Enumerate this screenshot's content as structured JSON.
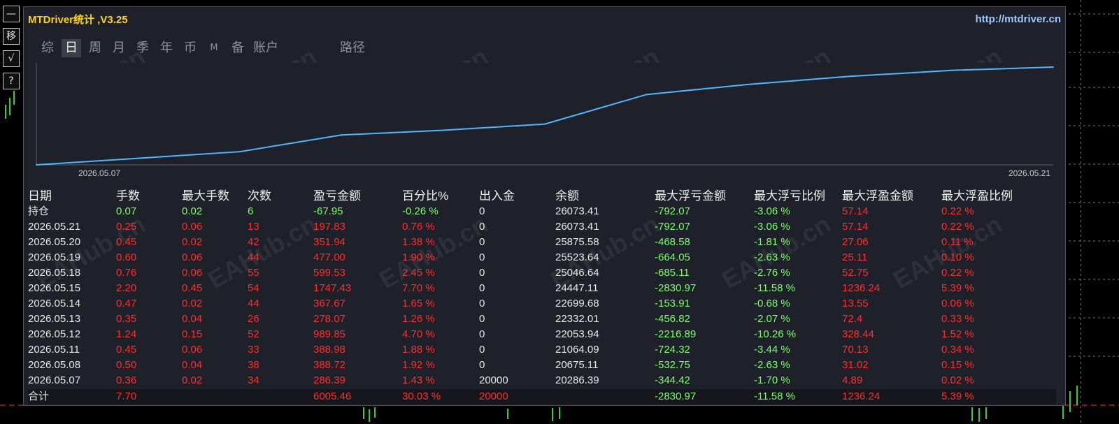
{
  "window": {
    "title": "MTDriver统计 ,V3.25",
    "url": "http://mtdriver.cn"
  },
  "side_tools": [
    "—",
    "移",
    "√",
    "?"
  ],
  "tabs": [
    {
      "label": "综",
      "active": false
    },
    {
      "label": "日",
      "active": true
    },
    {
      "label": "周",
      "active": false
    },
    {
      "label": "月",
      "active": false
    },
    {
      "label": "季",
      "active": false
    },
    {
      "label": "年",
      "active": false
    },
    {
      "label": "币",
      "active": false
    },
    {
      "label": "M",
      "active": false
    },
    {
      "label": "备",
      "active": false
    },
    {
      "label": "账户",
      "active": false
    },
    {
      "label": "路径",
      "active": false
    }
  ],
  "watermark": "EAHub.cn",
  "colors": {
    "line": "#4fb6ff",
    "profit": "#ff2d2d",
    "loss": "#7dff6a",
    "title": "#ffd400"
  },
  "chart_data": {
    "type": "line",
    "x": [
      "2026.05.07",
      "2026.05.08",
      "2026.05.11",
      "2026.05.12",
      "2026.05.13",
      "2026.05.14",
      "2026.05.15",
      "2026.05.18",
      "2026.05.19",
      "2026.05.20",
      "2026.05.21"
    ],
    "series": [
      {
        "values": [
          20286.39,
          20675.11,
          21064.09,
          22053.94,
          22332.01,
          22699.68,
          24447.11,
          25046.64,
          25523.64,
          25875.58,
          26073.41
        ]
      }
    ],
    "xtick_labels": [
      "2026.05.07",
      "2026.05.21"
    ]
  },
  "table": {
    "headers": [
      "日期",
      "手数",
      "最大手数",
      "次数",
      "盈亏金额",
      "百分比%",
      "出入金",
      "余额",
      "最大浮亏金额",
      "最大浮亏比例",
      "最大浮盈金额",
      "最大浮盈比例"
    ],
    "rows": [
      [
        "持仓",
        "0.07",
        "0.02",
        "6",
        "-67.95",
        "-0.26 %",
        "0",
        "26073.41",
        "-792.07",
        "-3.06 %",
        "57.14",
        "0.22 %"
      ],
      [
        "2026.05.21",
        "0.25",
        "0.06",
        "13",
        "197.83",
        "0.76 %",
        "0",
        "26073.41",
        "-792.07",
        "-3.06 %",
        "57.14",
        "0.22 %"
      ],
      [
        "2026.05.20",
        "0.45",
        "0.02",
        "42",
        "351.94",
        "1.38 %",
        "0",
        "25875.58",
        "-468.58",
        "-1.81 %",
        "27.06",
        "0.11 %"
      ],
      [
        "2026.05.19",
        "0.60",
        "0.06",
        "44",
        "477.00",
        "1.90 %",
        "0",
        "25523.64",
        "-664.05",
        "-2.63 %",
        "25.11",
        "0.10 %"
      ],
      [
        "2026.05.18",
        "0.76",
        "0.06",
        "55",
        "599.53",
        "2.45 %",
        "0",
        "25046.64",
        "-685.11",
        "-2.76 %",
        "52.75",
        "0.22 %"
      ],
      [
        "2026.05.15",
        "2.20",
        "0.45",
        "54",
        "1747.43",
        "7.70 %",
        "0",
        "24447.11",
        "-2830.97",
        "-11.58 %",
        "1236.24",
        "5.39 %"
      ],
      [
        "2026.05.14",
        "0.47",
        "0.02",
        "44",
        "367.67",
        "1.65 %",
        "0",
        "22699.68",
        "-153.91",
        "-0.68 %",
        "13.55",
        "0.06 %"
      ],
      [
        "2026.05.13",
        "0.35",
        "0.04",
        "26",
        "278.07",
        "1.26 %",
        "0",
        "22332.01",
        "-456.82",
        "-2.07 %",
        "72.4",
        "0.33 %"
      ],
      [
        "2026.05.12",
        "1.24",
        "0.15",
        "52",
        "989.85",
        "4.70 %",
        "0",
        "22053.94",
        "-2216.89",
        "-10.26 %",
        "328.44",
        "1.52 %"
      ],
      [
        "2026.05.11",
        "0.45",
        "0.06",
        "33",
        "388.98",
        "1.88 %",
        "0",
        "21064.09",
        "-724.32",
        "-3.44 %",
        "70.13",
        "0.34 %"
      ],
      [
        "2026.05.08",
        "0.50",
        "0.04",
        "38",
        "388.72",
        "1.92 %",
        "0",
        "20675.11",
        "-532.75",
        "-2.63 %",
        "31.02",
        "0.15 %"
      ],
      [
        "2026.05.07",
        "0.36",
        "0.02",
        "34",
        "286.39",
        "1.43 %",
        "20000",
        "20286.39",
        "-344.42",
        "-1.70 %",
        "4.89",
        "0.02 %"
      ]
    ],
    "total": [
      "合计",
      "7.70",
      "",
      "",
      "6005.46",
      "30.03 %",
      "20000",
      "",
      "-2830.97",
      "-11.58 %",
      "1236.24",
      "5.39 %"
    ]
  }
}
